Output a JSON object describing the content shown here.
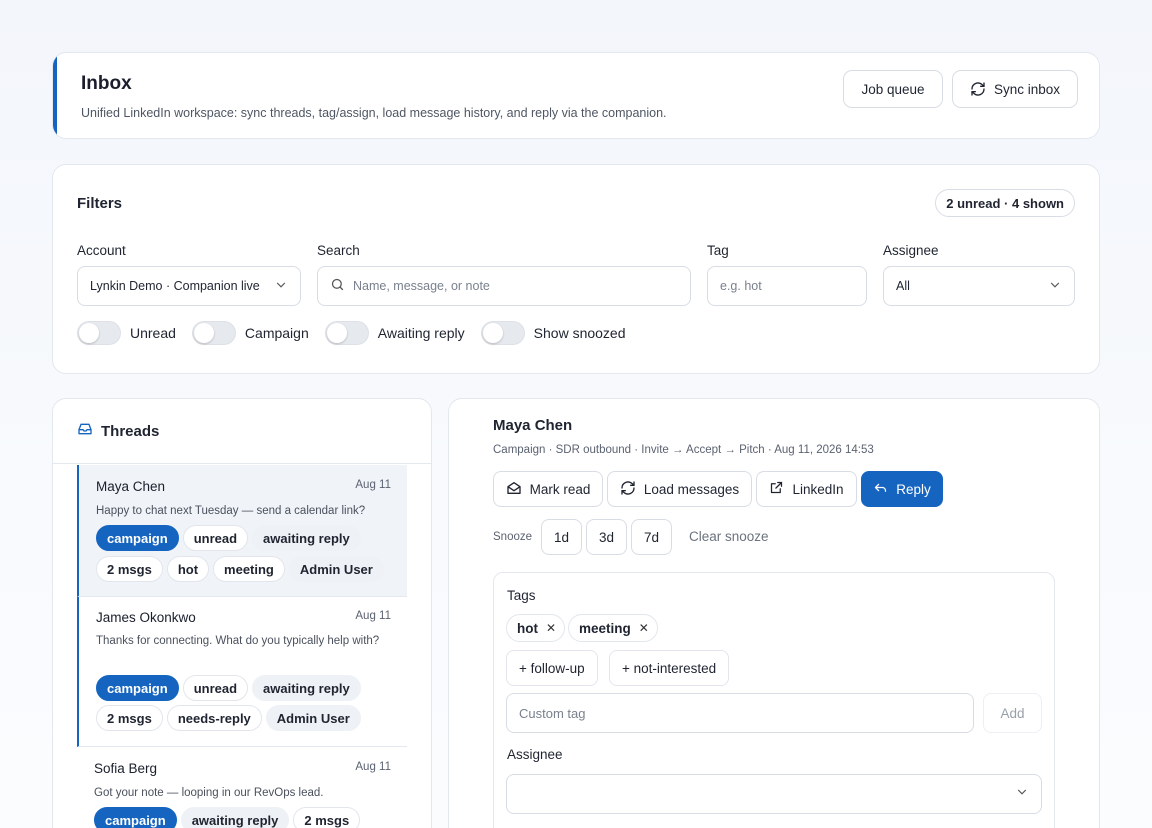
{
  "header": {
    "title": "Inbox",
    "subtitle": "Unified LinkedIn workspace: sync threads, tag/assign, load message history, and reply via the companion.",
    "job_queue_label": "Job queue",
    "sync_inbox_label": "Sync inbox",
    "accent_color": "#1565c0"
  },
  "filters": {
    "title": "Filters",
    "summary_badge": "2 unread · 4 shown",
    "account": {
      "label": "Account",
      "value": "Lynkin Demo · Companion live"
    },
    "search": {
      "label": "Search",
      "placeholder": "Name, message, or note"
    },
    "tag": {
      "label": "Tag",
      "placeholder": "e.g. hot"
    },
    "assignee": {
      "label": "Assignee",
      "value": "All"
    },
    "toggles": [
      {
        "label": "Unread",
        "on": false
      },
      {
        "label": "Campaign",
        "on": false
      },
      {
        "label": "Awaiting reply",
        "on": false
      },
      {
        "label": "Show snoozed",
        "on": false
      }
    ]
  },
  "threads": {
    "title": "Threads",
    "items": [
      {
        "name": "Maya Chen",
        "date": "Aug 11",
        "snippet": "Happy to chat next Tuesday — send a calendar link?",
        "chips_row1": [
          {
            "text": "campaign",
            "style": "blue"
          },
          {
            "text": "unread",
            "style": "outline"
          },
          {
            "text": "awaiting reply",
            "style": "gray"
          }
        ],
        "chips_row2": [
          {
            "text": "2 msgs",
            "style": "outline"
          },
          {
            "text": "hot",
            "style": "outline"
          },
          {
            "text": "meeting",
            "style": "outline"
          },
          {
            "text": "Admin User",
            "style": "gray"
          }
        ]
      },
      {
        "name": "James Okonkwo",
        "date": "Aug 11",
        "snippet": "Thanks for connecting. What do you typically help with?",
        "chips_row1": [
          {
            "text": "campaign",
            "style": "blue"
          },
          {
            "text": "unread",
            "style": "outline"
          },
          {
            "text": "awaiting reply",
            "style": "gray"
          }
        ],
        "chips_row2": [
          {
            "text": "2 msgs",
            "style": "outline"
          },
          {
            "text": "needs-reply",
            "style": "outline"
          },
          {
            "text": "Admin User",
            "style": "gray"
          }
        ]
      },
      {
        "name": "Sofia Berg",
        "date": "Aug 11",
        "snippet": "Got your note — looping in our RevOps lead.",
        "chips_row1": [
          {
            "text": "campaign",
            "style": "blue"
          },
          {
            "text": "awaiting reply",
            "style": "gray"
          },
          {
            "text": "2 msgs",
            "style": "outline"
          }
        ],
        "chips_row2": []
      }
    ]
  },
  "detail": {
    "name": "Maya Chen",
    "meta": "Campaign · SDR outbound · Invite → Accept → Pitch · Aug 11, 2026 14:53",
    "actions": {
      "mark_read": "Mark read",
      "load_messages": "Load messages",
      "linkedin": "LinkedIn",
      "reply": "Reply"
    },
    "snooze": {
      "label": "Snooze",
      "options": [
        "1d",
        "3d",
        "7d"
      ],
      "clear": "Clear snooze"
    },
    "tags": {
      "title": "Tags",
      "current": [
        "hot",
        "meeting"
      ],
      "suggestions": [
        "+ follow-up",
        "+ not-interested"
      ],
      "custom_placeholder": "Custom tag",
      "add_label": "Add"
    },
    "assignee": {
      "title": "Assignee",
      "value": ""
    }
  }
}
